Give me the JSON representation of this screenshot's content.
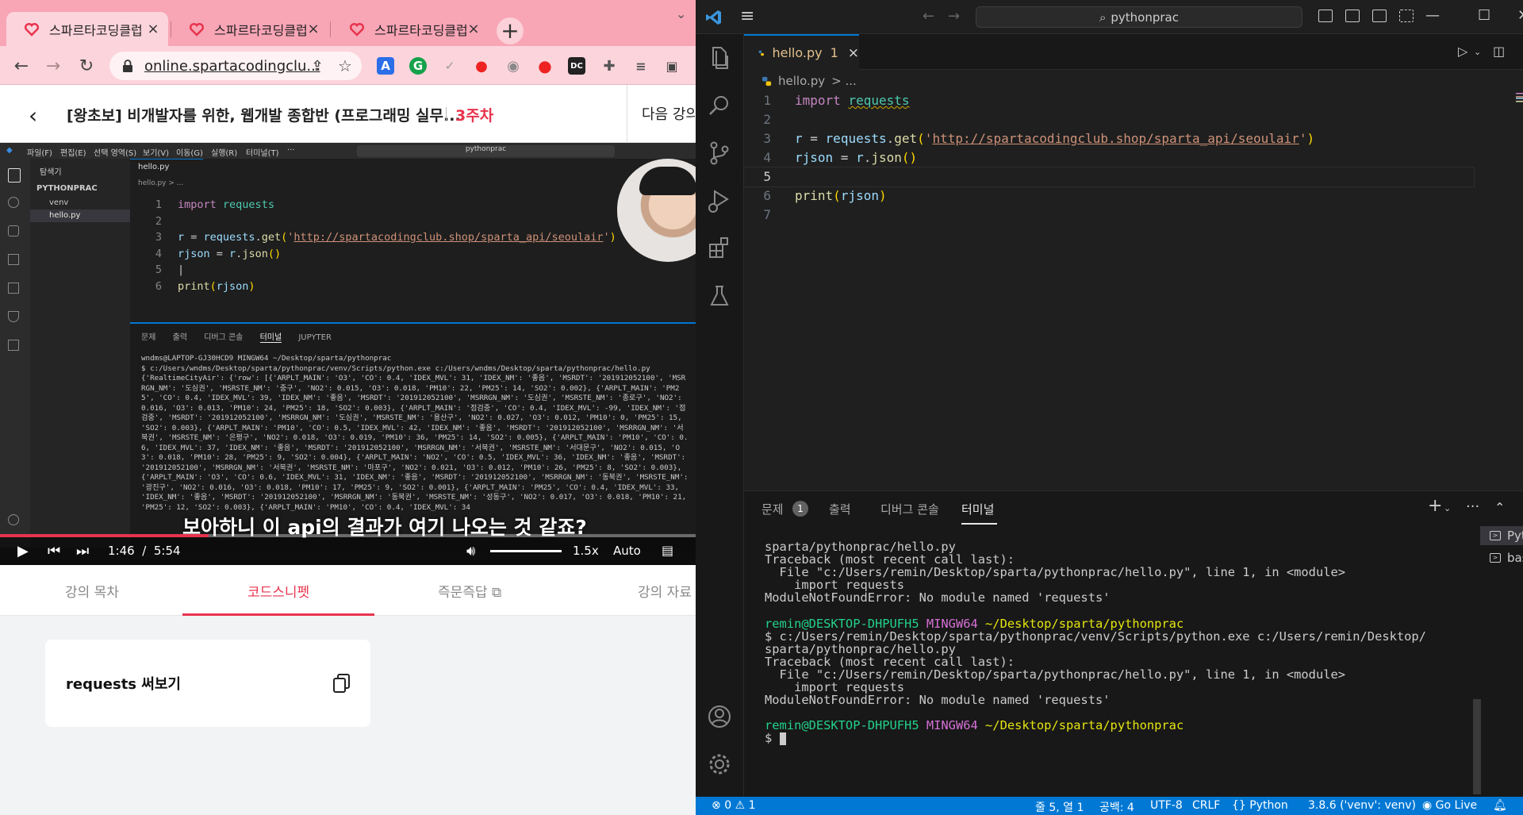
{
  "browser": {
    "tabs": [
      {
        "title": "스파르타코딩클럽",
        "close": "×"
      },
      {
        "title": "스파르타코딩클럽",
        "close": "×"
      },
      {
        "title": "스파르타코딩클럽",
        "close": "×"
      }
    ],
    "new_tab": "+",
    "url": "online.spartacodingclu...",
    "extensions": [
      "A",
      "G",
      "✓",
      "●",
      "◉",
      "●",
      "DC"
    ]
  },
  "course": {
    "title": "[왕초보] 비개발자를 위한, 웹개발 종합반 (프로그래밍 실무...",
    "week": "3주차",
    "next_label": "다음 강의"
  },
  "video": {
    "inner_menu": [
      "파일(F)",
      "편집(E)",
      "선택 영역(S)",
      "보기(V)",
      "이동(G)",
      "실행(R)",
      "터미널(T)",
      "···"
    ],
    "inner_search": "pythonprac",
    "inner_sidebar_title": "탐색기",
    "inner_project": "PYTHONPRAC",
    "inner_tree": [
      "venv",
      "hello.py"
    ],
    "inner_tab": "hello.py",
    "inner_breadcrumb": "hello.py > ...",
    "inner_code": [
      {
        "n": "1",
        "text": "import requests"
      },
      {
        "n": "2",
        "text": ""
      },
      {
        "n": "3",
        "text": "r = requests.get('http://spartacodingclub.shop/sparta_api/seoulair')"
      },
      {
        "n": "4",
        "text": "rjson = r.json()"
      },
      {
        "n": "5",
        "text": "|"
      },
      {
        "n": "6",
        "text": "print(rjson)"
      }
    ],
    "inner_terminal_tabs": [
      "문제",
      "출력",
      "디버그 콘솔",
      "터미널",
      "JUPYTER"
    ],
    "inner_terminal_text": "wndms@LAPTOP-GJ30HCD9 MINGW64 ~/Desktop/sparta/pythonprac\n$ c:/Users/wndms/Desktop/sparta/pythonprac/venv/Scripts/python.exe c:/Users/wndms/Desktop/sparta/pythonprac/hello.py\n{'RealtimeCityAir': {'row': [{'ARPLT_MAIN': 'O3', 'CO': 0.4, 'IDEX_MVL': 31, 'IDEX_NM': '좋음', 'MSRDT': '201912052100', 'MSRRGN_NM': '도심권', 'MSRSTE_NM': '중구', 'NO2': 0.015, 'O3': 0.018, 'PM10': 22, 'PM25': 14, 'SO2': 0.002}, {'ARPLT_MAIN': 'PM25', 'CO': 0.4, 'IDEX_MVL': 39, 'IDEX_NM': '좋음', 'MSRDT': '201912052100', 'MSRRGN_NM': '도심권', 'MSRSTE_NM': '종로구', 'NO2': 0.016, 'O3': 0.013, 'PM10': 24, 'PM25': 18, 'SO2': 0.003}, {'ARPLT_MAIN': '점검중', 'CO': 0.4, 'IDEX_MVL': -99, 'IDEX_NM': '점검중', 'MSRDT': '201912052100', 'MSRRGN_NM': '도심권', 'MSRSTE_NM': '용산구', 'NO2': 0.027, 'O3': 0.012, 'PM10': 0, 'PM25': 15, 'SO2': 0.003}, {'ARPLT_MAIN': 'PM10', 'CO': 0.5, 'IDEX_MVL': 42, 'IDEX_NM': '좋음', 'MSRDT': '201912052100', 'MSRRGN_NM': '서북권', 'MSRSTE_NM': '은평구', 'NO2': 0.018, 'O3': 0.019, 'PM10': 36, 'PM25': 14, 'SO2': 0.005}, {'ARPLT_MAIN': 'PM10', 'CO': 0.6, 'IDEX_MVL': 37, 'IDEX_NM': '좋음', 'MSRDT': '201912052100', 'MSRRGN_NM': '서북권', 'MSRSTE_NM': '서대문구', 'NO2': 0.015, 'O3': 0.018, 'PM10': 28, 'PM25': 9, 'SO2': 0.004}, {'ARPLT_MAIN': 'NO2', 'CO': 0.5, 'IDEX_MVL': 36, 'IDEX_NM': '좋음', 'MSRDT': '201912052100', 'MSRRGN_NM': '서북권', 'MSRSTE_NM': '마포구', 'NO2': 0.021, 'O3': 0.012, 'PM10': 26, 'PM25': 8, 'SO2': 0.003}, {'ARPLT_MAIN': 'O3', 'CO': 0.6, 'IDEX_MVL': 31, 'IDEX_NM': '좋음', 'MSRDT': '201912052100', 'MSRRGN_NM': '동북권', 'MSRSTE_NM': '광진구', 'NO2': 0.016, 'O3': 0.018, 'PM10': 17, 'PM25': 9, 'SO2': 0.001}, {'ARPLT_MAIN': 'PM25', 'CO': 0.4, 'IDEX_MVL': 33, 'IDEX_NM': '좋음', 'MSRDT': '201912052100', 'MSRRGN_NM': '동북권', 'MSRSTE_NM': '성동구', 'NO2': 0.017, 'O3': 0.018, 'PM10': 21, 'PM25': 12, 'SO2': 0.003}, {'ARPLT_MAIN': 'PM10', 'CO': 0.4, 'IDEX_MVL': 34",
    "subtitle": "보아하니 이 api의 결과가 여기 나오는 것 같죠?",
    "time_current": "1:46",
    "time_sep": "/",
    "time_total": "5:54",
    "progress_fraction": 0.3,
    "speed": "1.5x",
    "quality": "Auto"
  },
  "lesson_tabs": [
    {
      "label": "강의 목차",
      "active": false
    },
    {
      "label": "코드스니펫",
      "active": true
    },
    {
      "label": "즉문즉답",
      "active": false
    },
    {
      "label": "강의 자료",
      "active": false
    }
  ],
  "snippet": {
    "title": "requests 써보기"
  },
  "vscode": {
    "search": "pythonprac",
    "tab": {
      "name": "hello.py",
      "problems": "1",
      "close": "×"
    },
    "breadcrumb": {
      "file": "hello.py",
      "sep": "> ..."
    },
    "code_lines": [
      {
        "n": "1",
        "html_parts": [
          [
            "kw",
            "import"
          ],
          [
            "pun",
            " "
          ],
          [
            "mod",
            "requests"
          ]
        ]
      },
      {
        "n": "2",
        "html_parts": []
      },
      {
        "n": "3",
        "html_parts": [
          [
            "var",
            "r"
          ],
          [
            "pun",
            " = "
          ],
          [
            "var",
            "requests"
          ],
          [
            "pun",
            "."
          ],
          [
            "fn",
            "get"
          ],
          [
            "brk",
            "("
          ],
          [
            "str",
            "'"
          ],
          [
            "str url",
            "http://spartacodingclub.shop/sparta_api/seoulair"
          ],
          [
            "str",
            "'"
          ],
          [
            "brk",
            ")"
          ]
        ]
      },
      {
        "n": "4",
        "html_parts": [
          [
            "var",
            "rjson"
          ],
          [
            "pun",
            " = "
          ],
          [
            "var",
            "r"
          ],
          [
            "pun",
            "."
          ],
          [
            "fn",
            "json"
          ],
          [
            "brk",
            "()"
          ]
        ]
      },
      {
        "n": "5",
        "html_parts": []
      },
      {
        "n": "6",
        "html_parts": [
          [
            "fn",
            "print"
          ],
          [
            "brk",
            "("
          ],
          [
            "var",
            "rjson"
          ],
          [
            "brk",
            ")"
          ]
        ]
      },
      {
        "n": "7",
        "html_parts": []
      }
    ],
    "panel_tabs": [
      {
        "label": "문제",
        "active": false
      },
      {
        "label": "출력",
        "active": false
      },
      {
        "label": "디버그 콘솔",
        "active": false
      },
      {
        "label": "터미널",
        "active": true
      }
    ],
    "panel_problems_badge": "1",
    "terminal_lines": [
      [
        [
          "",
          "sparta/pythonprac/hello.py"
        ]
      ],
      [
        [
          "",
          "Traceback (most recent call last):"
        ]
      ],
      [
        [
          "",
          "  File \"c:/Users/remin/Desktop/sparta/pythonprac/hello.py\", line 1, in <module>"
        ]
      ],
      [
        [
          "",
          "    import requests"
        ]
      ],
      [
        [
          "",
          "ModuleNotFoundError: No module named 'requests'"
        ]
      ],
      [
        [
          "",
          ""
        ]
      ],
      [
        [
          "t-green",
          "remin@DESKTOP-DHPUFH5"
        ],
        [
          "",
          " "
        ],
        [
          "t-mag",
          "MINGW64"
        ],
        [
          "",
          " "
        ],
        [
          "t-yel",
          "~/Desktop/sparta/pythonprac"
        ]
      ],
      [
        [
          "",
          "$ c:/Users/remin/Desktop/sparta/pythonprac/venv/Scripts/python.exe c:/Users/remin/Desktop/"
        ]
      ],
      [
        [
          "",
          "sparta/pythonprac/hello.py"
        ]
      ],
      [
        [
          "",
          "Traceback (most recent call last):"
        ]
      ],
      [
        [
          "",
          "  File \"c:/Users/remin/Desktop/sparta/pythonprac/hello.py\", line 1, in <module>"
        ]
      ],
      [
        [
          "",
          "    import requests"
        ]
      ],
      [
        [
          "",
          "ModuleNotFoundError: No module named 'requests'"
        ]
      ],
      [
        [
          "",
          ""
        ]
      ],
      [
        [
          "t-green",
          "remin@DESKTOP-DHPUFH5"
        ],
        [
          "",
          " "
        ],
        [
          "t-mag",
          "MINGW64"
        ],
        [
          "",
          " "
        ],
        [
          "t-yel",
          "~/Desktop/sparta/pythonprac"
        ]
      ],
      [
        [
          "",
          "$ "
        ]
      ]
    ],
    "terminals": [
      {
        "label": "Python",
        "active": true
      },
      {
        "label": "bash",
        "active": false
      }
    ],
    "status": {
      "errors": "0",
      "warnings": "1",
      "position": "줄 5, 열 1",
      "spaces": "공백: 4",
      "encoding": "UTF-8",
      "eol": "CRLF",
      "language": "Python",
      "interpreter": "3.8.6 ('venv': venv)",
      "golive": "Go Live"
    }
  },
  "colors": {
    "accent": "#e8344e",
    "vscode_blue": "#0078d4",
    "tabstrip": "#f8a5b5"
  }
}
